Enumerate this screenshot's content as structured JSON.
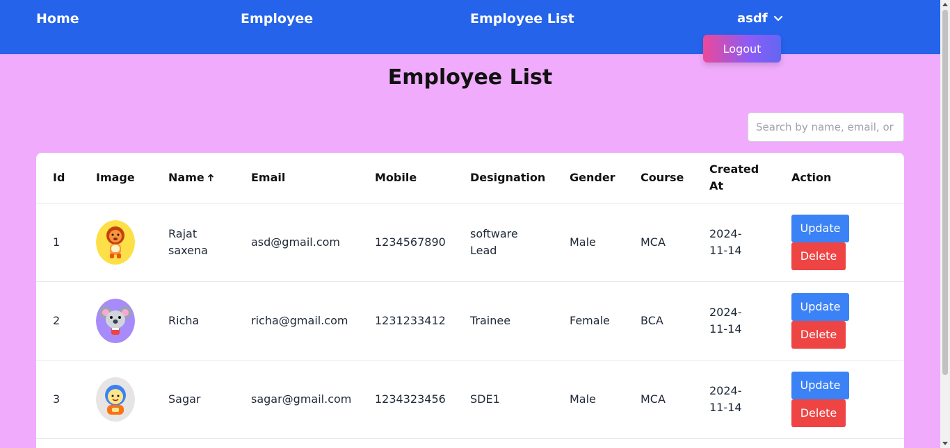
{
  "nav": {
    "home": "Home",
    "employee": "Employee",
    "employee_list": "Employee List",
    "username": "asdf",
    "logout": "Logout"
  },
  "page": {
    "title": "Employee List"
  },
  "search": {
    "placeholder": "Search by name, email, or mobile"
  },
  "table": {
    "headers": {
      "id": "Id",
      "image": "Image",
      "name": "Name",
      "email": "Email",
      "mobile": "Mobile",
      "designation": "Designation",
      "gender": "Gender",
      "course": "Course",
      "created_at": "Created At",
      "action": "Action"
    },
    "sort": {
      "column": "Name",
      "direction": "ascending"
    },
    "rows": [
      {
        "id": "1",
        "avatar": "lion-avatar",
        "name": "Rajat saxena",
        "email": "asd@gmail.com",
        "mobile": "1234567890",
        "designation": "software Lead",
        "gender": "Male",
        "course": "MCA",
        "created_at": "2024-11-14"
      },
      {
        "id": "2",
        "avatar": "koala-avatar",
        "name": "Richa",
        "email": "richa@gmail.com",
        "mobile": "1231233412",
        "designation": "Trainee",
        "gender": "Female",
        "course": "BCA",
        "created_at": "2024-11-14"
      },
      {
        "id": "3",
        "avatar": "monk-avatar",
        "name": "Sagar",
        "email": "sagar@gmail.com",
        "mobile": "1234323456",
        "designation": "SDE1",
        "gender": "Male",
        "course": "MCA",
        "created_at": "2024-11-14"
      }
    ],
    "update_label": "Update",
    "delete_label": "Delete"
  },
  "colors": {
    "navbar": "#2563eb",
    "page_background": "#f0abfc",
    "update_button": "#3b82f6",
    "delete_button": "#ef4444"
  }
}
